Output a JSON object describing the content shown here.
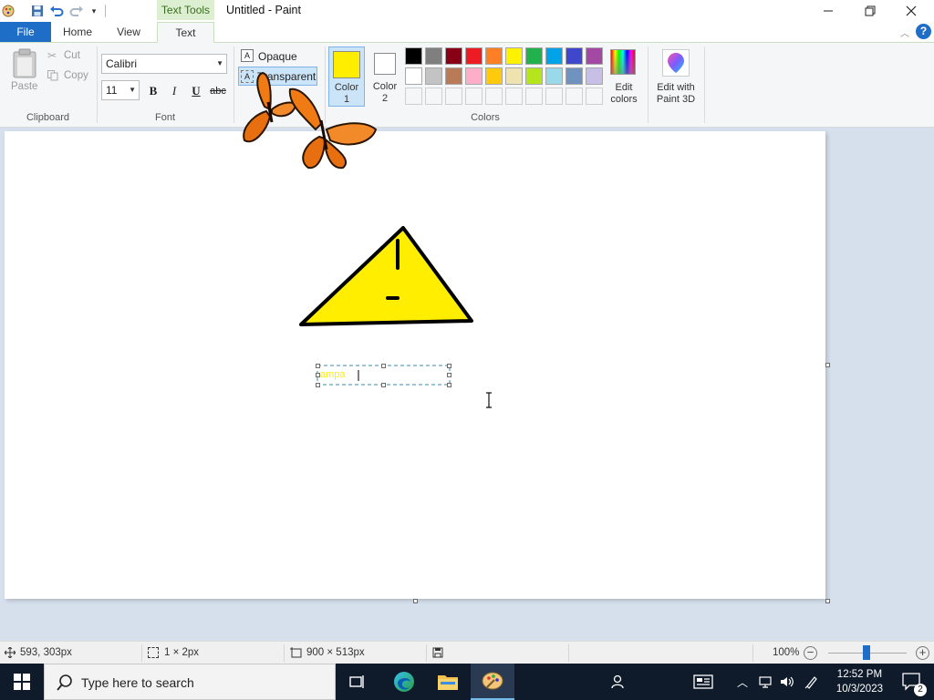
{
  "titlebar": {
    "context_tab": "Text Tools",
    "title": "Untitled - Paint"
  },
  "tabs": {
    "file": "File",
    "home": "Home",
    "view": "View",
    "text": "Text"
  },
  "clipboard": {
    "paste": "Paste",
    "cut": "Cut",
    "copy": "Copy",
    "group_label": "Clipboard"
  },
  "font": {
    "family": "Calibri",
    "size": "11",
    "bold": "B",
    "italic": "I",
    "underline": "U",
    "strike": "abc",
    "group_label": "Font"
  },
  "background": {
    "opaque": "Opaque",
    "transparent": "Transparent"
  },
  "colors": {
    "color1_label_a": "Color",
    "color1_label_b": "1",
    "color2_label_a": "Color",
    "color2_label_b": "2",
    "color1_value": "#ffee00",
    "color2_value": "#ffffff",
    "edit_colors_a": "Edit",
    "edit_colors_b": "colors",
    "group_label": "Colors",
    "palette_row1": [
      "#000000",
      "#7f7f7f",
      "#880015",
      "#ed1c24",
      "#ff7f27",
      "#fff200",
      "#22b14c",
      "#00a2e8",
      "#3f48cc",
      "#a349a4"
    ],
    "palette_row2": [
      "#ffffff",
      "#c3c3c3",
      "#b97a57",
      "#ffaec9",
      "#ffc90e",
      "#efe4b0",
      "#b5e61d",
      "#99d9ea",
      "#7092be",
      "#c8bfe7"
    ]
  },
  "paint3d": {
    "label_a": "Edit with",
    "label_b": "Paint 3D"
  },
  "canvas": {
    "textbox_content": "ampa"
  },
  "status": {
    "cursor_pos": "593, 303px",
    "selection_size": "1 × 2px",
    "image_size": "900 × 513px",
    "zoom": "100%"
  },
  "taskbar": {
    "search_placeholder": "Type here to search",
    "time": "12:52 PM",
    "date": "10/3/2023",
    "notifications": "2"
  }
}
